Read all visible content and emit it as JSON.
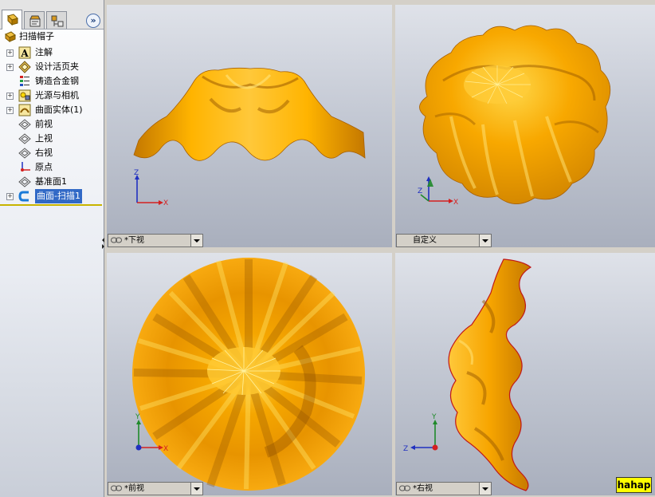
{
  "feature_tree": {
    "root": {
      "label": "扫描帽子",
      "icon": "part-icon"
    },
    "items": [
      {
        "label": "注解",
        "icon": "annotation-icon",
        "expandable": true
      },
      {
        "label": "设计活页夹",
        "icon": "design-binder-icon",
        "expandable": true
      },
      {
        "label": "铸造合金钢",
        "icon": "material-icon",
        "expandable": false
      },
      {
        "label": "光源与相机",
        "icon": "lights-camera-icon",
        "expandable": true
      },
      {
        "label": "曲面实体(1)",
        "icon": "surface-bodies-icon",
        "expandable": true
      },
      {
        "label": "前视",
        "icon": "plane-icon",
        "expandable": false
      },
      {
        "label": "上视",
        "icon": "plane-icon",
        "expandable": false
      },
      {
        "label": "右视",
        "icon": "plane-icon",
        "expandable": false
      },
      {
        "label": "原点",
        "icon": "origin-icon",
        "expandable": false
      },
      {
        "label": "基准面1",
        "icon": "plane-icon",
        "expandable": false
      },
      {
        "label": "曲面-扫描1",
        "icon": "surface-sweep-icon",
        "expandable": true,
        "selected": true
      }
    ],
    "tabs": [
      "feature-manager-icon",
      "property-manager-icon",
      "configuration-manager-icon"
    ],
    "expand_label": "»"
  },
  "viewports": {
    "top_left": {
      "view_label": "*下视",
      "axes": {
        "vertical": "Z",
        "horizontal": "X"
      }
    },
    "top_right": {
      "view_label": "自定义",
      "axes": {
        "vertical": "Z",
        "horizontal": "X"
      }
    },
    "bottom_left": {
      "view_label": "*前视",
      "axes": {
        "vertical": "Y",
        "horizontal": "X"
      }
    },
    "bottom_right": {
      "view_label": "*右视",
      "axes": {
        "vertical": "Y",
        "horizontal": "Z"
      }
    }
  },
  "watermark": "hahap",
  "colors": {
    "model_orange": "#f7a500",
    "model_highlight": "#ffd23a",
    "model_shadow": "#b56a00",
    "axis_x": "#d42020",
    "axis_y": "#1f8a2a",
    "axis_z": "#2030c0",
    "selection": "#3169c6"
  }
}
